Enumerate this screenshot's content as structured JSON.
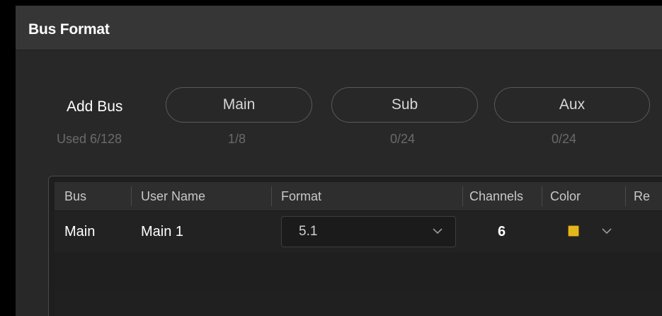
{
  "dialog": {
    "title": "Bus Format"
  },
  "add_bus": {
    "label": "Add Bus",
    "used": "Used 6/128",
    "buttons": [
      {
        "label": "Main",
        "count": "1/8"
      },
      {
        "label": "Sub",
        "count": "0/24"
      },
      {
        "label": "Aux",
        "count": "0/24"
      }
    ]
  },
  "table": {
    "headers": [
      "Bus",
      "User Name",
      "Format",
      "Channels",
      "Color",
      "Re"
    ],
    "rows": [
      {
        "bus": "Main",
        "user_name": "Main 1",
        "format": "5.1",
        "channels": "6",
        "color": "#e4b61c"
      }
    ]
  },
  "colors": {
    "accent_swatch": "#e4b61c",
    "panel": "#282828",
    "title_bar": "#363636"
  }
}
